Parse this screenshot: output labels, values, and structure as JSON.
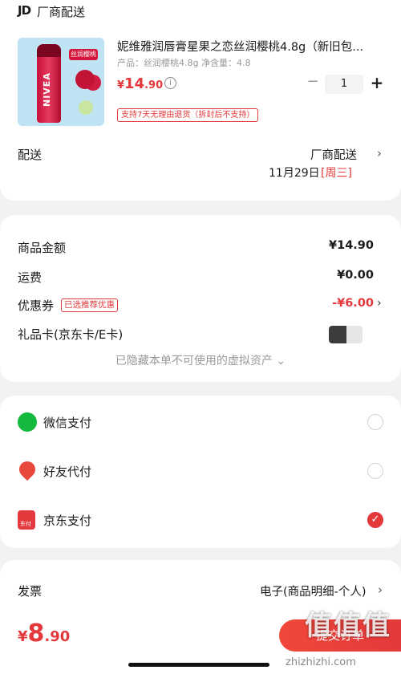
{
  "shop": {
    "logo": "JD",
    "name": "厂商配送"
  },
  "product": {
    "title": "妮维雅润唇膏星果之恋丝润樱桃4.8g（新旧包...",
    "spec": "产品：丝润樱桃4.8g   净含量：4.8",
    "price_symbol": "¥",
    "price_int": "14",
    "price_dec": ".90",
    "image_brand": "NIVEA",
    "image_tag": "丝润樱桃",
    "quantity": "1",
    "return_policy": "支持7天无理由退货（拆封后不支持）"
  },
  "shipping": {
    "label": "配送",
    "method": "厂商配送",
    "date": "11月29日",
    "weekday": "[周三]"
  },
  "price_summary": {
    "goods_label": "商品金额",
    "goods_value": "¥14.90",
    "freight_label": "运费",
    "freight_value": "¥0.00",
    "coupon_label": "优惠券",
    "coupon_badge": "已选推荐优惠",
    "coupon_value": "-¥6.00",
    "giftcard_label": "礼品卡(京东卡/E卡)",
    "giftcard_enabled": false,
    "hidden_note": "已隐藏本单不可使用的虚拟资产 ⌄"
  },
  "payment": {
    "options": [
      {
        "label": "微信支付",
        "icon": "wechat-pay-icon",
        "selected": false
      },
      {
        "label": "好友代付",
        "icon": "friend-pay-icon",
        "selected": false
      },
      {
        "label": "京东支付",
        "icon": "jd-pay-icon",
        "selected": true
      }
    ],
    "jd_icon_text": "东付"
  },
  "invoice": {
    "label": "发票",
    "value": "电子(商品明细-个人)"
  },
  "footer": {
    "total_symbol": "¥",
    "total_int": "8",
    "total_dec": ".90",
    "submit_label": "提交订单",
    "watermark": "值值值",
    "watermark_url": "zhizhizhi.com"
  },
  "colors": {
    "accent": "#e4393c",
    "wechat": "#15b93f"
  }
}
